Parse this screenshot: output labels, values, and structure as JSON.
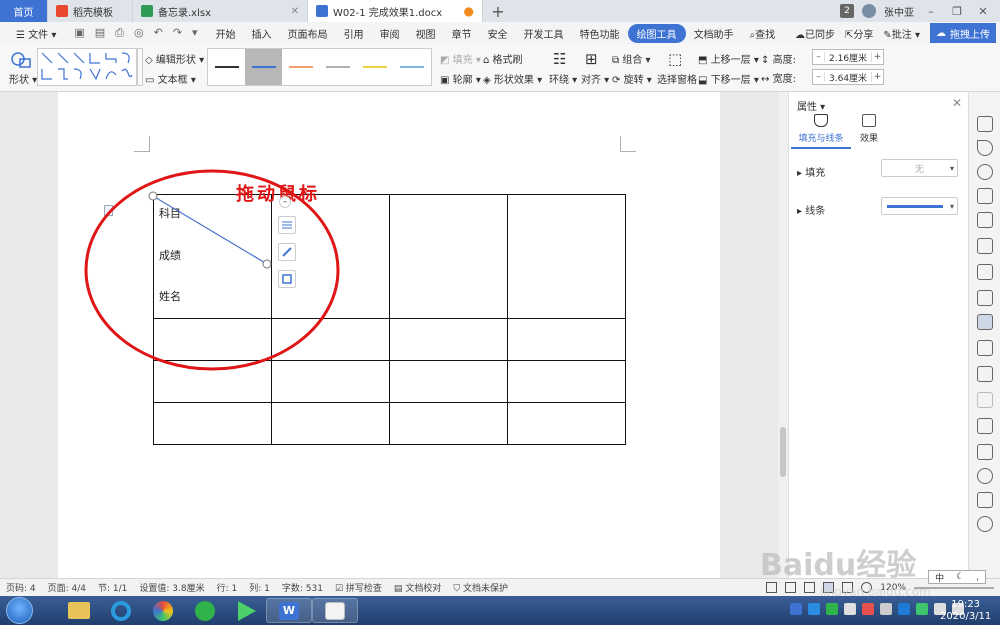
{
  "tabs": [
    {
      "label": "首页",
      "kind": "home"
    },
    {
      "label": "稻壳模板",
      "kind": "docer",
      "color": "#e8482b"
    },
    {
      "label": "备忘录.xlsx",
      "kind": "xlsx",
      "color": "#2f9b55"
    },
    {
      "label": "W02-1 完成效果1.docx",
      "kind": "docx",
      "color": "#3e73d4"
    }
  ],
  "titlebar": {
    "badge": "2",
    "user": "张中亚"
  },
  "menu": {
    "file": "文件",
    "items": [
      "开始",
      "插入",
      "页面布局",
      "引用",
      "审阅",
      "视图",
      "章节",
      "安全",
      "开发工具",
      "特色功能",
      "绘图工具",
      "文档助手"
    ],
    "active": "绘图工具",
    "search": "查找",
    "sync": "已同步",
    "share": "分享",
    "comment": "批注",
    "upload": "拖拽上传"
  },
  "ribbon": {
    "shape": "形状",
    "edit_shape": "编辑形状",
    "text_box": "文本框",
    "fill": "填充",
    "format_painter": "格式刷",
    "outline": "轮廓",
    "shape_effect": "形状效果",
    "wrap": "环绕",
    "align": "对齐",
    "group": "组合",
    "rotate": "旋转",
    "select_pane": "选择窗格",
    "bring_forward": "上移一层",
    "send_backward": "下移一层",
    "height_label": "高度:",
    "height_value": "2.16厘米",
    "width_label": "宽度:",
    "width_value": "3.64厘米",
    "line_colors": [
      "#333333",
      "#3e73d4",
      "#f0a070",
      "#b0b0b0",
      "#f0d040",
      "#7fb6e0"
    ]
  },
  "document": {
    "hint": "拖动鼠标",
    "cell_labels": [
      "科目",
      "成绩",
      "姓名"
    ]
  },
  "properties": {
    "title": "属性",
    "tab_fill_line": "填充与线条",
    "tab_effect": "效果",
    "fill_label": "填充",
    "fill_value": "无",
    "line_label": "线条",
    "line_color": "#3e73d4"
  },
  "status": {
    "page_num": "页码: 4",
    "page_count": "页面: 4/4",
    "section": "节: 1/1",
    "setting": "设置值: 3.8厘米",
    "row": "行: 1",
    "col": "列: 1",
    "words": "字数: 531",
    "spell": "拼写检查",
    "proof": "文档校对",
    "protect": "文档未保护",
    "zoom": "120%"
  },
  "taskbar": {
    "time": "19:23",
    "date": "2020/3/11"
  },
  "watermark": {
    "brand": "Baidu经验",
    "url": "jingyan.baidu.com"
  },
  "ime": {
    "mode": "中"
  }
}
